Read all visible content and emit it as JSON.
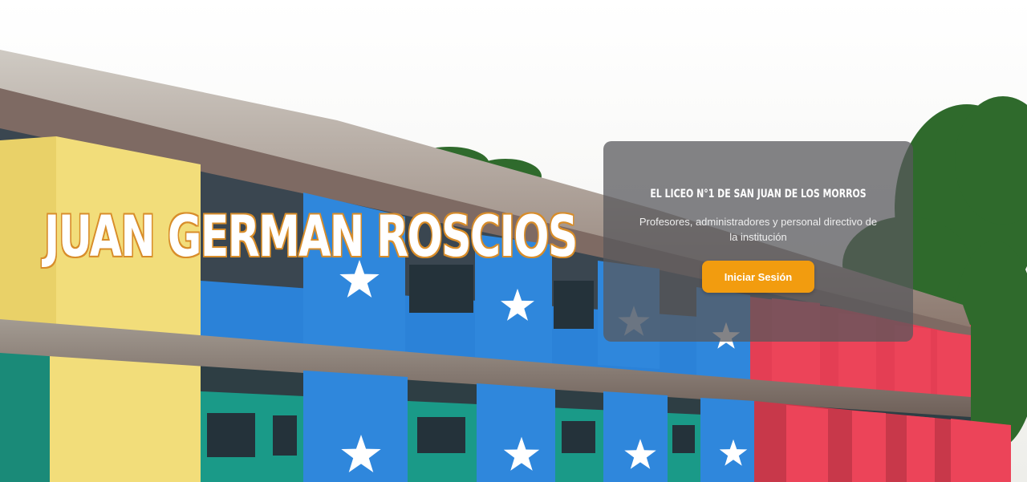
{
  "hero": {
    "title": "JUAN GERMAN ROSCIOS",
    "image_alt": "school-building-photo"
  },
  "login_card": {
    "heading": "EL LICEO N°1 DE SAN JUAN DE LOS MORROS",
    "description": "Profesores, administradores y personal directivo de la institución",
    "button_label": "Iniciar Sesión"
  },
  "colors": {
    "accent": "#f29c0f",
    "title_outline": "#d88d2a",
    "card_background": "#58585c",
    "wall_yellow": "#f2dd7a",
    "wall_blue": "#2b82d8",
    "wall_red": "#e43e54",
    "wall_teal": "#1a9a88"
  }
}
